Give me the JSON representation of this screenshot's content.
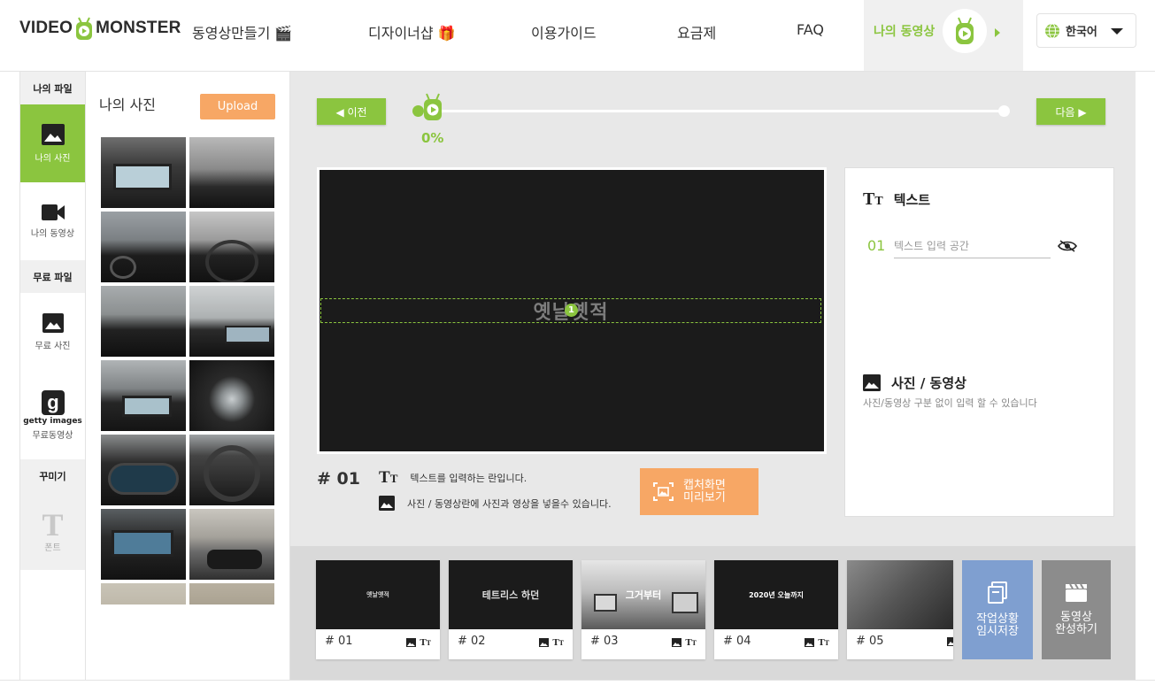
{
  "header": {
    "logo_left": "VIDEO",
    "logo_right": "MONSTER",
    "nav": [
      {
        "label": "동영상만들기 🎬"
      },
      {
        "label": "디자이너샵 🎁"
      },
      {
        "label": "이용가이드"
      },
      {
        "label": "요금제"
      },
      {
        "label": "FAQ"
      }
    ],
    "my_video": "나의 동영상",
    "language": "한국어"
  },
  "sidebar": {
    "section_my_files": "나의 파일",
    "my_photos": "나의 사진",
    "my_videos": "나의 동영상",
    "section_free_files": "무료 파일",
    "free_photos": "무료 사진",
    "getty_brand": "getty images",
    "free_videos": "무료동영상",
    "section_decorate": "꾸미기",
    "font": "폰트"
  },
  "photos_panel": {
    "title": "나의 사진",
    "upload_label": "Upload"
  },
  "editor": {
    "prev_label": "◀ 이전",
    "next_label": "다음 ▶",
    "progress": "0%",
    "preview_text": "옛날옛적",
    "text_badge": "1",
    "scene_number": "# 01",
    "hint_text": "텍스트를 입력하는 란입니다.",
    "hint_media": "사진 / 동영상란에 사진과 영상을 넣을수 있습니다.",
    "capture_line1": "캡처화면",
    "capture_line2": "미리보기"
  },
  "properties": {
    "text_heading": "텍스트",
    "text_index": "01",
    "text_placeholder": "텍스트 입력 공간",
    "media_heading": "사진 / 동영상",
    "media_desc": "사진/동영상 구분 없이 입력 할 수 있습니다"
  },
  "scenes": [
    {
      "label": "# 01",
      "caption": "옛날옛적"
    },
    {
      "label": "# 02",
      "caption": "테트리스 하던"
    },
    {
      "label": "# 03",
      "caption": "그거부터"
    },
    {
      "label": "# 04",
      "caption": "2020년 오늘까지"
    },
    {
      "label": "# 05",
      "caption": ""
    }
  ],
  "actions": {
    "save_line1": "작업상황",
    "save_line2": "임시저장",
    "complete_line1": "동영상",
    "complete_line2": "완성하기"
  },
  "colors": {
    "accent_green": "#8bc53f",
    "accent_orange": "#f7a765",
    "save_blue": "#7f9fd0",
    "complete_gray": "#8c8c8c"
  }
}
